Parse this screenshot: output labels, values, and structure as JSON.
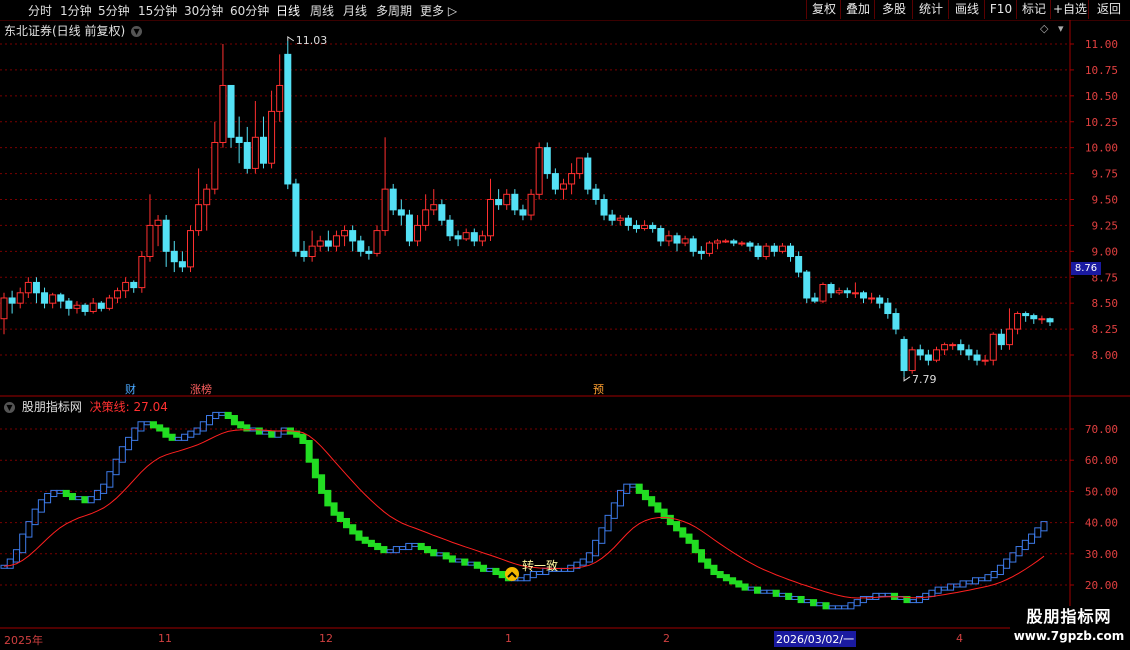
{
  "toolbar": {
    "periods": [
      "分时",
      "1分钟",
      "5分钟",
      "15分钟",
      "30分钟",
      "60分钟",
      "日线",
      "周线",
      "月线",
      "多周期",
      "更多"
    ],
    "active_period": "日线",
    "right_buttons": [
      "复权",
      "叠加",
      "多股",
      "统计",
      "画线",
      "F10",
      "标记",
      "+自选",
      "返回"
    ]
  },
  "main_chart": {
    "title": "东北证券(日线 前复权)",
    "high_label": "11.03",
    "low_label": "7.79",
    "current_price": "8.76",
    "y_ticks": [
      "11.00",
      "10.75",
      "10.50",
      "10.25",
      "10.00",
      "9.75",
      "9.50",
      "9.25",
      "9.00",
      "8.75",
      "8.50",
      "8.25",
      "8.00"
    ],
    "markers": [
      {
        "text": "财",
        "color": "#4aa8ff"
      },
      {
        "text": "涨榜",
        "color": "#ff6060"
      },
      {
        "text": "预",
        "color": "#ffa030"
      }
    ]
  },
  "indicator": {
    "name": "股朋指标网",
    "line_name": "决策线:",
    "line_value": "27.04",
    "y_ticks": [
      "70.00",
      "60.00",
      "50.00",
      "40.00",
      "30.00",
      "20.00"
    ],
    "signal_text": "转一致"
  },
  "time_axis": {
    "labels": [
      "2025年",
      "11",
      "12",
      "1",
      "2",
      "4"
    ],
    "current_date": "2026/03/02/一"
  },
  "watermark": {
    "line1": "股朋指标网",
    "line2": "www.7gpzb.com"
  },
  "colors": {
    "up": "#ff3030",
    "down": "#54e1f5",
    "ind_up": "#3d7ae8",
    "ind_down": "#22dd22",
    "decision": "#ff2020",
    "grid": "#7a0000"
  },
  "chart_data": {
    "type": "candlestick",
    "ylim": [
      7.6,
      11.2
    ],
    "candles": [
      [
        8.35,
        8.55,
        8.2,
        8.6
      ],
      [
        8.55,
        8.5,
        8.4,
        8.62
      ],
      [
        8.5,
        8.6,
        8.45,
        8.65
      ],
      [
        8.6,
        8.7,
        8.55,
        8.75
      ],
      [
        8.7,
        8.6,
        8.5,
        8.75
      ],
      [
        8.6,
        8.5,
        8.45,
        8.65
      ],
      [
        8.5,
        8.58,
        8.45,
        8.6
      ],
      [
        8.58,
        8.52,
        8.45,
        8.6
      ],
      [
        8.52,
        8.45,
        8.38,
        8.55
      ],
      [
        8.45,
        8.48,
        8.4,
        8.52
      ],
      [
        8.48,
        8.42,
        8.38,
        8.5
      ],
      [
        8.42,
        8.5,
        8.4,
        8.55
      ],
      [
        8.5,
        8.45,
        8.42,
        8.52
      ],
      [
        8.45,
        8.55,
        8.43,
        8.58
      ],
      [
        8.55,
        8.62,
        8.5,
        8.65
      ],
      [
        8.62,
        8.7,
        8.55,
        8.75
      ],
      [
        8.7,
        8.65,
        8.6,
        8.72
      ],
      [
        8.65,
        8.95,
        8.6,
        9.0
      ],
      [
        8.95,
        9.25,
        8.9,
        9.55
      ],
      [
        9.25,
        9.3,
        9.05,
        9.35
      ],
      [
        9.3,
        9.0,
        8.85,
        9.35
      ],
      [
        9.0,
        8.9,
        8.8,
        9.1
      ],
      [
        8.9,
        8.85,
        8.8,
        9.0
      ],
      [
        8.85,
        9.2,
        8.8,
        9.25
      ],
      [
        9.2,
        9.45,
        9.15,
        9.8
      ],
      [
        9.45,
        9.6,
        9.2,
        9.65
      ],
      [
        9.6,
        10.05,
        9.55,
        10.25
      ],
      [
        10.05,
        10.6,
        10.0,
        11.0
      ],
      [
        10.6,
        10.1,
        10.0,
        10.4
      ],
      [
        10.1,
        10.05,
        9.85,
        10.3
      ],
      [
        10.05,
        9.8,
        9.75,
        10.2
      ],
      [
        9.8,
        10.1,
        9.75,
        10.45
      ],
      [
        10.1,
        9.85,
        9.8,
        10.3
      ],
      [
        9.85,
        10.35,
        9.8,
        10.55
      ],
      [
        10.35,
        10.6,
        10.25,
        10.9
      ],
      [
        10.9,
        9.65,
        9.6,
        11.03
      ],
      [
        9.65,
        9.0,
        8.95,
        9.7
      ],
      [
        9.0,
        8.95,
        8.9,
        9.1
      ],
      [
        8.95,
        9.05,
        8.9,
        9.2
      ],
      [
        9.05,
        9.1,
        9.0,
        9.15
      ],
      [
        9.1,
        9.05,
        9.0,
        9.2
      ],
      [
        9.05,
        9.15,
        9.0,
        9.2
      ],
      [
        9.15,
        9.2,
        9.05,
        9.25
      ],
      [
        9.2,
        9.1,
        9.0,
        9.25
      ],
      [
        9.1,
        9.0,
        8.95,
        9.15
      ],
      [
        9.0,
        8.98,
        8.92,
        9.05
      ],
      [
        8.98,
        9.2,
        8.95,
        9.25
      ],
      [
        9.2,
        9.6,
        9.15,
        10.1
      ],
      [
        9.6,
        9.4,
        9.35,
        9.65
      ],
      [
        9.4,
        9.35,
        9.25,
        9.5
      ],
      [
        9.35,
        9.1,
        9.05,
        9.4
      ],
      [
        9.1,
        9.25,
        9.05,
        9.35
      ],
      [
        9.25,
        9.4,
        9.2,
        9.55
      ],
      [
        9.4,
        9.45,
        9.35,
        9.6
      ],
      [
        9.45,
        9.3,
        9.25,
        9.5
      ],
      [
        9.3,
        9.15,
        9.1,
        9.35
      ],
      [
        9.15,
        9.12,
        9.05,
        9.2
      ],
      [
        9.12,
        9.18,
        9.1,
        9.22
      ],
      [
        9.18,
        9.1,
        9.05,
        9.22
      ],
      [
        9.1,
        9.15,
        9.05,
        9.2
      ],
      [
        9.15,
        9.5,
        9.1,
        9.7
      ],
      [
        9.5,
        9.45,
        9.4,
        9.6
      ],
      [
        9.45,
        9.55,
        9.4,
        9.6
      ],
      [
        9.55,
        9.4,
        9.35,
        9.6
      ],
      [
        9.4,
        9.35,
        9.3,
        9.45
      ],
      [
        9.35,
        9.55,
        9.3,
        9.6
      ],
      [
        9.55,
        10.0,
        9.5,
        10.05
      ],
      [
        10.0,
        9.75,
        9.7,
        10.05
      ],
      [
        9.75,
        9.6,
        9.55,
        9.8
      ],
      [
        9.6,
        9.65,
        9.5,
        9.7
      ],
      [
        9.65,
        9.75,
        9.55,
        9.85
      ],
      [
        9.75,
        9.9,
        9.7,
        9.9
      ],
      [
        9.9,
        9.6,
        9.55,
        9.95
      ],
      [
        9.6,
        9.5,
        9.45,
        9.65
      ],
      [
        9.5,
        9.35,
        9.3,
        9.55
      ],
      [
        9.35,
        9.3,
        9.25,
        9.4
      ],
      [
        9.3,
        9.32,
        9.25,
        9.35
      ],
      [
        9.32,
        9.25,
        9.2,
        9.35
      ],
      [
        9.25,
        9.22,
        9.18,
        9.3
      ],
      [
        9.22,
        9.25,
        9.2,
        9.3
      ],
      [
        9.25,
        9.22,
        9.18,
        9.28
      ],
      [
        9.22,
        9.1,
        9.05,
        9.25
      ],
      [
        9.1,
        9.15,
        9.05,
        9.2
      ],
      [
        9.15,
        9.08,
        9.0,
        9.18
      ],
      [
        9.08,
        9.12,
        9.05,
        9.15
      ],
      [
        9.12,
        9.0,
        8.95,
        9.15
      ],
      [
        9.0,
        8.98,
        8.92,
        9.05
      ],
      [
        8.98,
        9.08,
        8.95,
        9.1
      ],
      [
        9.08,
        9.1,
        9.02,
        9.12
      ],
      [
        9.1,
        9.1,
        9.08,
        9.12
      ],
      [
        9.1,
        9.08,
        9.05,
        9.12
      ],
      [
        9.08,
        9.08,
        9.05,
        9.1
      ],
      [
        9.08,
        9.05,
        9.0,
        9.1
      ],
      [
        9.05,
        8.95,
        8.92,
        9.08
      ],
      [
        8.95,
        9.05,
        8.92,
        9.08
      ],
      [
        9.05,
        9.0,
        8.95,
        9.08
      ],
      [
        9.0,
        9.05,
        8.98,
        9.08
      ],
      [
        9.05,
        8.95,
        8.9,
        9.08
      ],
      [
        8.95,
        8.8,
        8.75,
        9.0
      ],
      [
        8.8,
        8.55,
        8.5,
        8.82
      ],
      [
        8.55,
        8.52,
        8.5,
        8.6
      ],
      [
        8.52,
        8.68,
        8.5,
        8.7
      ],
      [
        8.68,
        8.6,
        8.55,
        8.7
      ],
      [
        8.6,
        8.62,
        8.58,
        8.65
      ],
      [
        8.62,
        8.6,
        8.55,
        8.65
      ],
      [
        8.6,
        8.6,
        8.55,
        8.7
      ],
      [
        8.6,
        8.55,
        8.5,
        8.62
      ],
      [
        8.55,
        8.55,
        8.5,
        8.6
      ],
      [
        8.55,
        8.5,
        8.45,
        8.58
      ],
      [
        8.5,
        8.4,
        8.35,
        8.55
      ],
      [
        8.4,
        8.25,
        8.2,
        8.45
      ],
      [
        8.15,
        7.85,
        7.79,
        8.18
      ],
      [
        7.85,
        8.05,
        7.82,
        8.08
      ],
      [
        8.05,
        8.0,
        7.95,
        8.1
      ],
      [
        8.0,
        7.95,
        7.9,
        8.05
      ],
      [
        7.95,
        8.05,
        7.93,
        8.08
      ],
      [
        8.05,
        8.1,
        8.0,
        8.12
      ],
      [
        8.1,
        8.1,
        8.05,
        8.12
      ],
      [
        8.1,
        8.05,
        8.0,
        8.15
      ],
      [
        8.05,
        8.0,
        7.95,
        8.1
      ],
      [
        8.0,
        7.95,
        7.9,
        8.05
      ],
      [
        7.95,
        7.95,
        7.9,
        8.0
      ],
      [
        7.95,
        8.2,
        7.9,
        8.22
      ],
      [
        8.2,
        8.1,
        8.05,
        8.25
      ],
      [
        8.1,
        8.25,
        8.05,
        8.45
      ],
      [
        8.25,
        8.4,
        8.2,
        8.42
      ],
      [
        8.4,
        8.38,
        8.32,
        8.42
      ],
      [
        8.38,
        8.35,
        8.3,
        8.4
      ],
      [
        8.35,
        8.35,
        8.3,
        8.38
      ],
      [
        8.35,
        8.32,
        8.28,
        8.36
      ]
    ]
  }
}
